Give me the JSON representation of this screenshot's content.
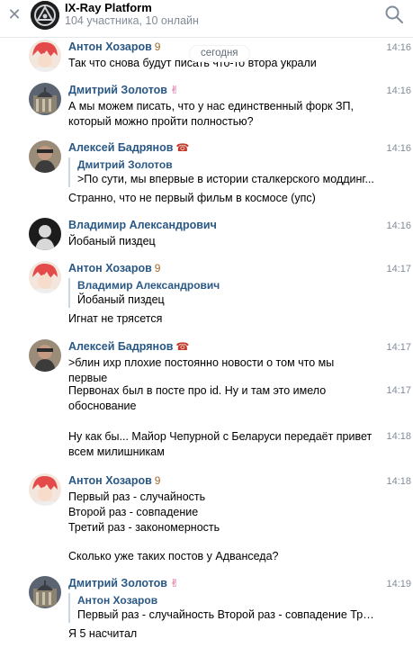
{
  "header": {
    "title": "IX-Ray Platform",
    "subtitle": "104 участника, 10 онлайн",
    "close_icon": "close-icon",
    "search_icon": "search-icon"
  },
  "date_separator": "сегодня",
  "messages": [
    {
      "author": "Антон Хозаров",
      "emoji": "9",
      "time": "14:16",
      "text": "Так что снова будут писать что-то втора украли"
    },
    {
      "author": "Дмитрий Золотов",
      "emoji": "✌",
      "time": "14:16",
      "text": "А мы можем писать, что у нас единственный форк ЗП, который можно пройти полностью?"
    },
    {
      "author": "Алексей Бадрянов",
      "emoji": "☎",
      "time": "14:16",
      "reply_author": "Дмитрий Золотов",
      "reply_text": ">По сути, мы впервые в истории сталкерского моддинг...",
      "text": "Странно, что не первый фильм в космосе (упс)"
    },
    {
      "author": "Владимир Александрович",
      "time": "14:16",
      "text": "Йобаный пиздец"
    },
    {
      "author": "Антон Хозаров",
      "emoji": "9",
      "time": "14:17",
      "reply_author": "Владимир Александрович",
      "reply_text": "Йобаный пиздец",
      "text": "Игнат не трясется"
    },
    {
      "author": "Алексей Бадрянов",
      "emoji": "☎",
      "time": "14:17",
      "text": ">блин ихр плохие постоянно новости о том что мы первые"
    },
    {
      "time": "14:17",
      "text": "Первонах был в посте про id. Ну и там это имело обоснование"
    },
    {
      "time": "14:18",
      "text": "Ну как бы... Майор Чепурной с Беларуси передаёт привет всем милишникам"
    },
    {
      "author": "Антон Хозаров",
      "emoji": "9",
      "time": "14:18",
      "text_lines": [
        "Первый раз - случайность",
        "Второй раз - совпадение",
        "Третий раз - закономерность"
      ]
    },
    {
      "text": "Сколько уже таких постов у Адванседа?"
    },
    {
      "author": "Дмитрий Золотов",
      "emoji": "✌",
      "time": "14:19",
      "reply_author": "Антон Хозаров",
      "reply_text": "Первый раз - случайность Второй раз - совпадение Трет...",
      "text": "Я 5 насчитал"
    }
  ]
}
